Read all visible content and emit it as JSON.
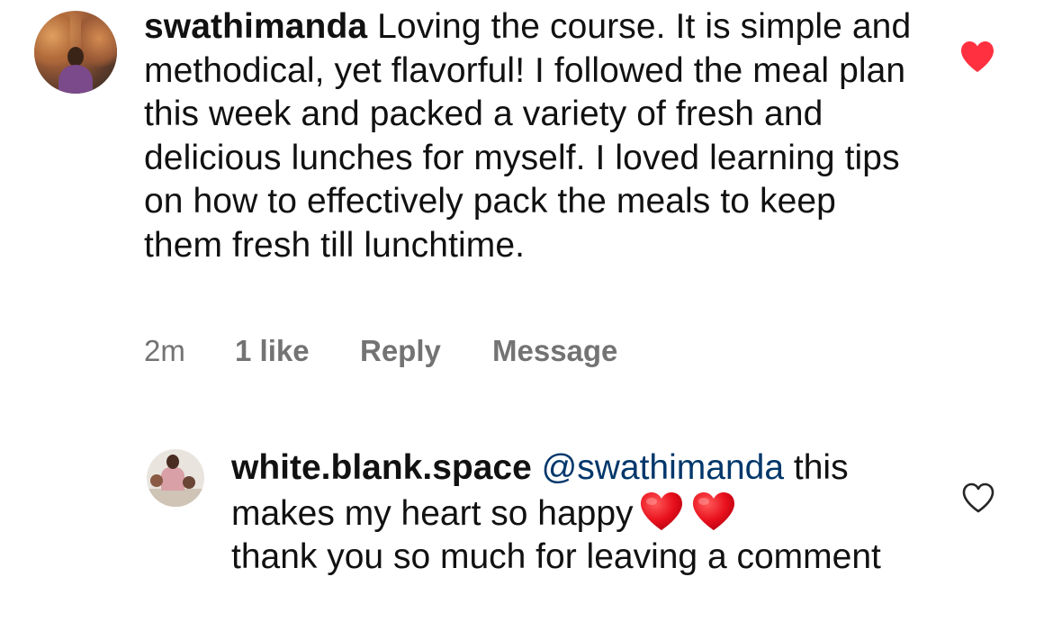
{
  "comment": {
    "username": "swathimanda",
    "text": "Loving the course. It is simple and methodical, yet flavorful! I followed the meal plan this week and packed a variety of fresh and delicious lunches for myself. I loved learning tips on how to effectively pack the meals to keep them fresh till lunchtime.",
    "time": "2m",
    "likes": "1 like",
    "reply_label": "Reply",
    "message_label": "Message",
    "liked": true
  },
  "reply": {
    "username": "white.blank.space",
    "mention": "@swathimanda",
    "text_part1": "this makes my heart so happy",
    "emojis": [
      "red-heart-emoji",
      "red-heart-emoji"
    ],
    "text_part2": "thank you so much for leaving a comment",
    "liked": false
  },
  "colors": {
    "like_active": "#ff3040",
    "meta_gray": "#737373",
    "mention_blue": "#00376b",
    "text": "#111111"
  },
  "icons": {
    "comment_like": "heart-filled-icon",
    "reply_like": "heart-outline-icon"
  }
}
